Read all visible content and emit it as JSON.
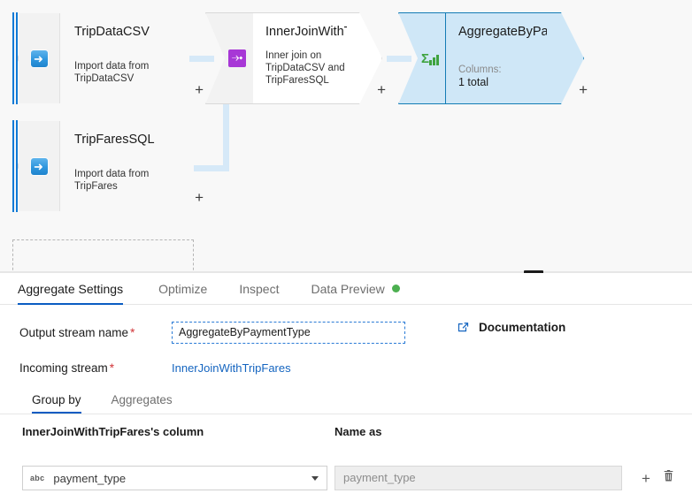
{
  "canvas": {
    "nodes": [
      {
        "id": "TripDataCSV",
        "title": "TripDataCSV",
        "subtitle": "Import data from TripDataCSV",
        "icon": "source-icon",
        "plus": "+"
      },
      {
        "id": "TripFaresSQL",
        "title": "TripFaresSQL",
        "subtitle": "Import data from TripFares",
        "icon": "source-icon",
        "plus": "+"
      },
      {
        "id": "InnerJoinWithTripFares",
        "title": "InnerJoinWithTripFares",
        "subtitle": "Inner join on TripDataCSV and TripFaresSQL",
        "icon": "join-icon",
        "plus": "+"
      },
      {
        "id": "AggregateByPaymentType",
        "title": "AggregateByPaymentTy...",
        "columns_label": "Columns:",
        "columns_value": "1 total",
        "icon": "aggregate-icon",
        "plus": "+",
        "selected": true
      }
    ],
    "accent_color": "#0f7ad6",
    "selected_fill": "#cfe7f7",
    "selected_border": "#137cb5",
    "connector_color": "#d6e9f8"
  },
  "panel": {
    "tabs": [
      {
        "label": "Aggregate Settings",
        "active": true
      },
      {
        "label": "Optimize",
        "active": false
      },
      {
        "label": "Inspect",
        "active": false
      },
      {
        "label": "Data Preview",
        "active": false,
        "status_dot": "#4caf50"
      }
    ],
    "form": {
      "output_stream_label": "Output stream name",
      "output_stream_required": "*",
      "output_stream_value": "AggregateByPaymentType",
      "output_stream_placeholder": "Output stream name",
      "incoming_stream_label": "Incoming stream",
      "incoming_stream_required": "*",
      "incoming_stream_value": "InnerJoinWithTripFares",
      "documentation_label": "Documentation",
      "documentation_icon": "external-link-icon"
    },
    "subtabs": [
      {
        "label": "Group by",
        "active": true
      },
      {
        "label": "Aggregates",
        "active": false
      }
    ],
    "grid": {
      "headers": [
        "InnerJoinWithTripFares's column",
        "Name as"
      ],
      "rows": [
        {
          "column_type_icon": "abc",
          "column_value": "payment_type",
          "name_as_value": "payment_type",
          "add_icon": "+",
          "delete_icon": "trash-icon"
        }
      ]
    }
  }
}
